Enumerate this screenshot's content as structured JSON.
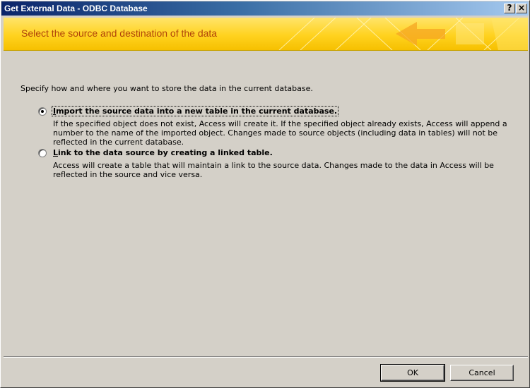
{
  "window": {
    "title": "Get External Data - ODBC Database",
    "help_glyph": "?",
    "close_glyph": "×"
  },
  "banner": {
    "heading": "Select the source and destination of the data"
  },
  "intro": "Specify how and where you want to store the data in the current database.",
  "options": [
    {
      "label_mnemonic": "I",
      "label_rest": "mport the source data into a new table in the current database.",
      "selected": true,
      "description": "If the specified object does not exist, Access will create it. If the specified object already exists, Access will append a number to the name of the imported object. Changes made to source objects (including data in tables) will not be reflected in the current database."
    },
    {
      "label_mnemonic": "L",
      "label_rest": "ink to the data source by creating a linked table.",
      "selected": false,
      "description": "Access will create a table that will maintain a link to the source data. Changes made to the data in Access will be reflected in the source and vice versa."
    }
  ],
  "buttons": {
    "ok": "OK",
    "cancel": "Cancel"
  },
  "colors": {
    "banner_text": "#b0440a",
    "banner_yellow": "#ffd21f",
    "title_bar": "#0a246a"
  }
}
